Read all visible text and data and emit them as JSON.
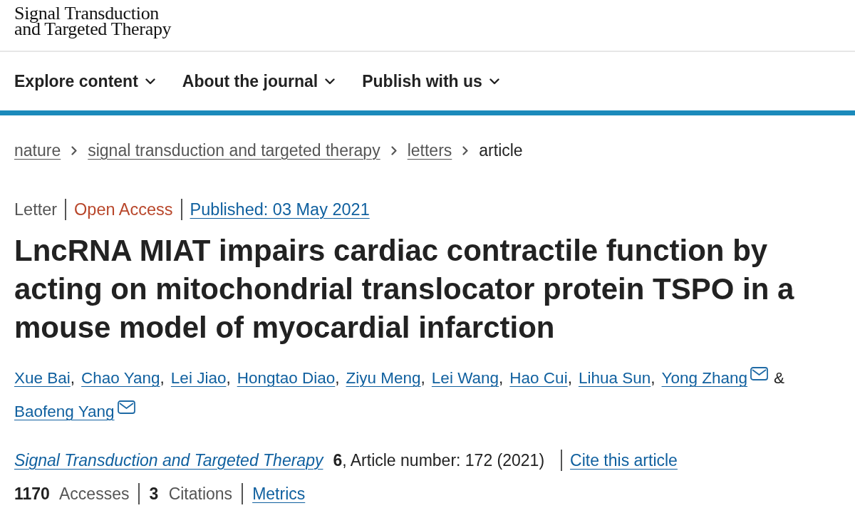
{
  "logo": {
    "lines": [
      "Signal Transduction",
      "and Targeted Therapy"
    ]
  },
  "nav": [
    {
      "label": "Explore content"
    },
    {
      "label": "About the journal"
    },
    {
      "label": "Publish with us"
    }
  ],
  "breadcrumbs": [
    {
      "label": "nature",
      "kind": "link"
    },
    {
      "label": "signal transduction and targeted therapy",
      "kind": "link"
    },
    {
      "label": "letters",
      "kind": "link"
    },
    {
      "label": "article",
      "kind": "current"
    }
  ],
  "article_info": {
    "type": "Letter",
    "access": "Open Access",
    "published": "Published: 03 May 2021"
  },
  "title": "LncRNA MIAT impairs cardiac contractile function by acting on mitochondrial translocator protein TSPO in a mouse model of myocardial infarction",
  "authors": [
    {
      "name": "Xue Bai",
      "corresponding": false,
      "separator": ","
    },
    {
      "name": "Chao Yang",
      "corresponding": false,
      "separator": ","
    },
    {
      "name": "Lei Jiao",
      "corresponding": false,
      "separator": ","
    },
    {
      "name": "Hongtao Diao",
      "corresponding": false,
      "separator": ","
    },
    {
      "name": "Ziyu Meng",
      "corresponding": false,
      "separator": ","
    },
    {
      "name": "Lei Wang",
      "corresponding": false,
      "separator": ","
    },
    {
      "name": "Hao Cui",
      "corresponding": false,
      "separator": ","
    },
    {
      "name": "Lihua Sun",
      "corresponding": false,
      "separator": ","
    },
    {
      "name": "Yong Zhang",
      "corresponding": true,
      "separator": "&"
    },
    {
      "name": "Baofeng Yang",
      "corresponding": true
    }
  ],
  "citation": {
    "journal": "Signal Transduction and Targeted Therapy",
    "details": "**6**, Article number: 172 (2021)",
    "cite_link": "Cite this article"
  },
  "metrics": [
    {
      "text": "**1170** Accesses"
    },
    {
      "text": "**3** Citations"
    }
  ],
  "metrics_link": "Metrics"
}
